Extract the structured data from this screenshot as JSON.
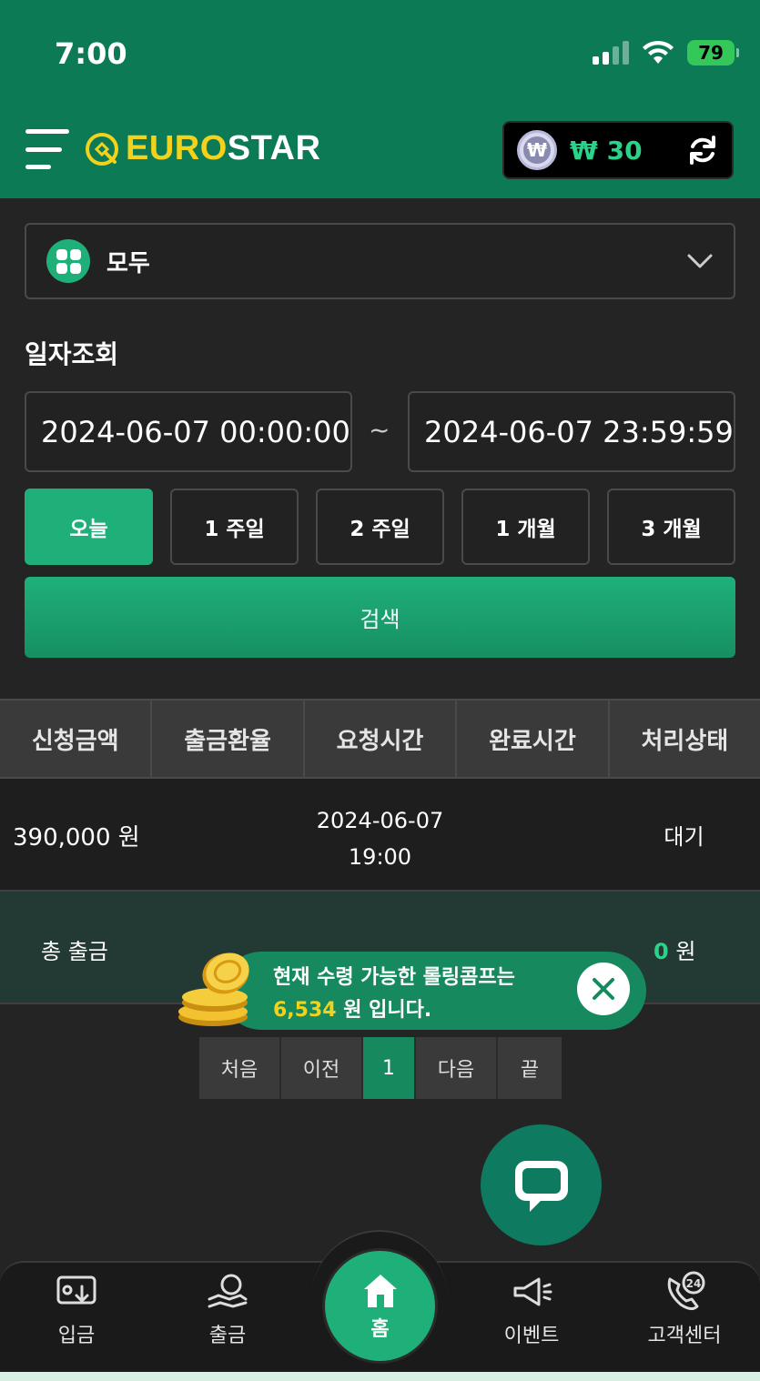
{
  "status_bar": {
    "time": "7:00",
    "battery": "79"
  },
  "header": {
    "logo_euro": "EURO",
    "logo_star": "STAR",
    "wallet_amount": "₩ 30",
    "won_symbol": "₩"
  },
  "filter": {
    "select_value": "모두",
    "date_title": "일자조회",
    "date_from": "2024-06-07 00:00:00",
    "date_to": "2024-06-07 23:59:59",
    "separator": "~",
    "periods": [
      "오늘",
      "1 주일",
      "2 주일",
      "1 개월",
      "3 개월"
    ],
    "search_label": "검색"
  },
  "table": {
    "headers": [
      "신청금액",
      "출금환율",
      "요청시간",
      "완료시간",
      "처리상태"
    ],
    "rows": [
      {
        "amount": "390,000 원",
        "request_date": "2024-06-07",
        "request_time": "19:00",
        "status": "대기"
      }
    ],
    "total_label": "총 출금",
    "total_value": "0",
    "total_unit": " 원"
  },
  "toast": {
    "line1": "현재 수령 가능한 롤링콤프는",
    "amount": "6,534",
    "line2_suffix": " 원 입니다."
  },
  "pagination": {
    "first": "처음",
    "prev": "이전",
    "current": "1",
    "next": "다음",
    "last": "끝"
  },
  "bottom_nav": {
    "deposit": "입금",
    "withdraw": "출금",
    "home": "홈",
    "event": "이벤트",
    "support": "고객센터"
  },
  "colors": {
    "brand_green": "#0d7a56",
    "accent_green": "#1fb07a",
    "logo_yellow": "#f2d21b"
  }
}
